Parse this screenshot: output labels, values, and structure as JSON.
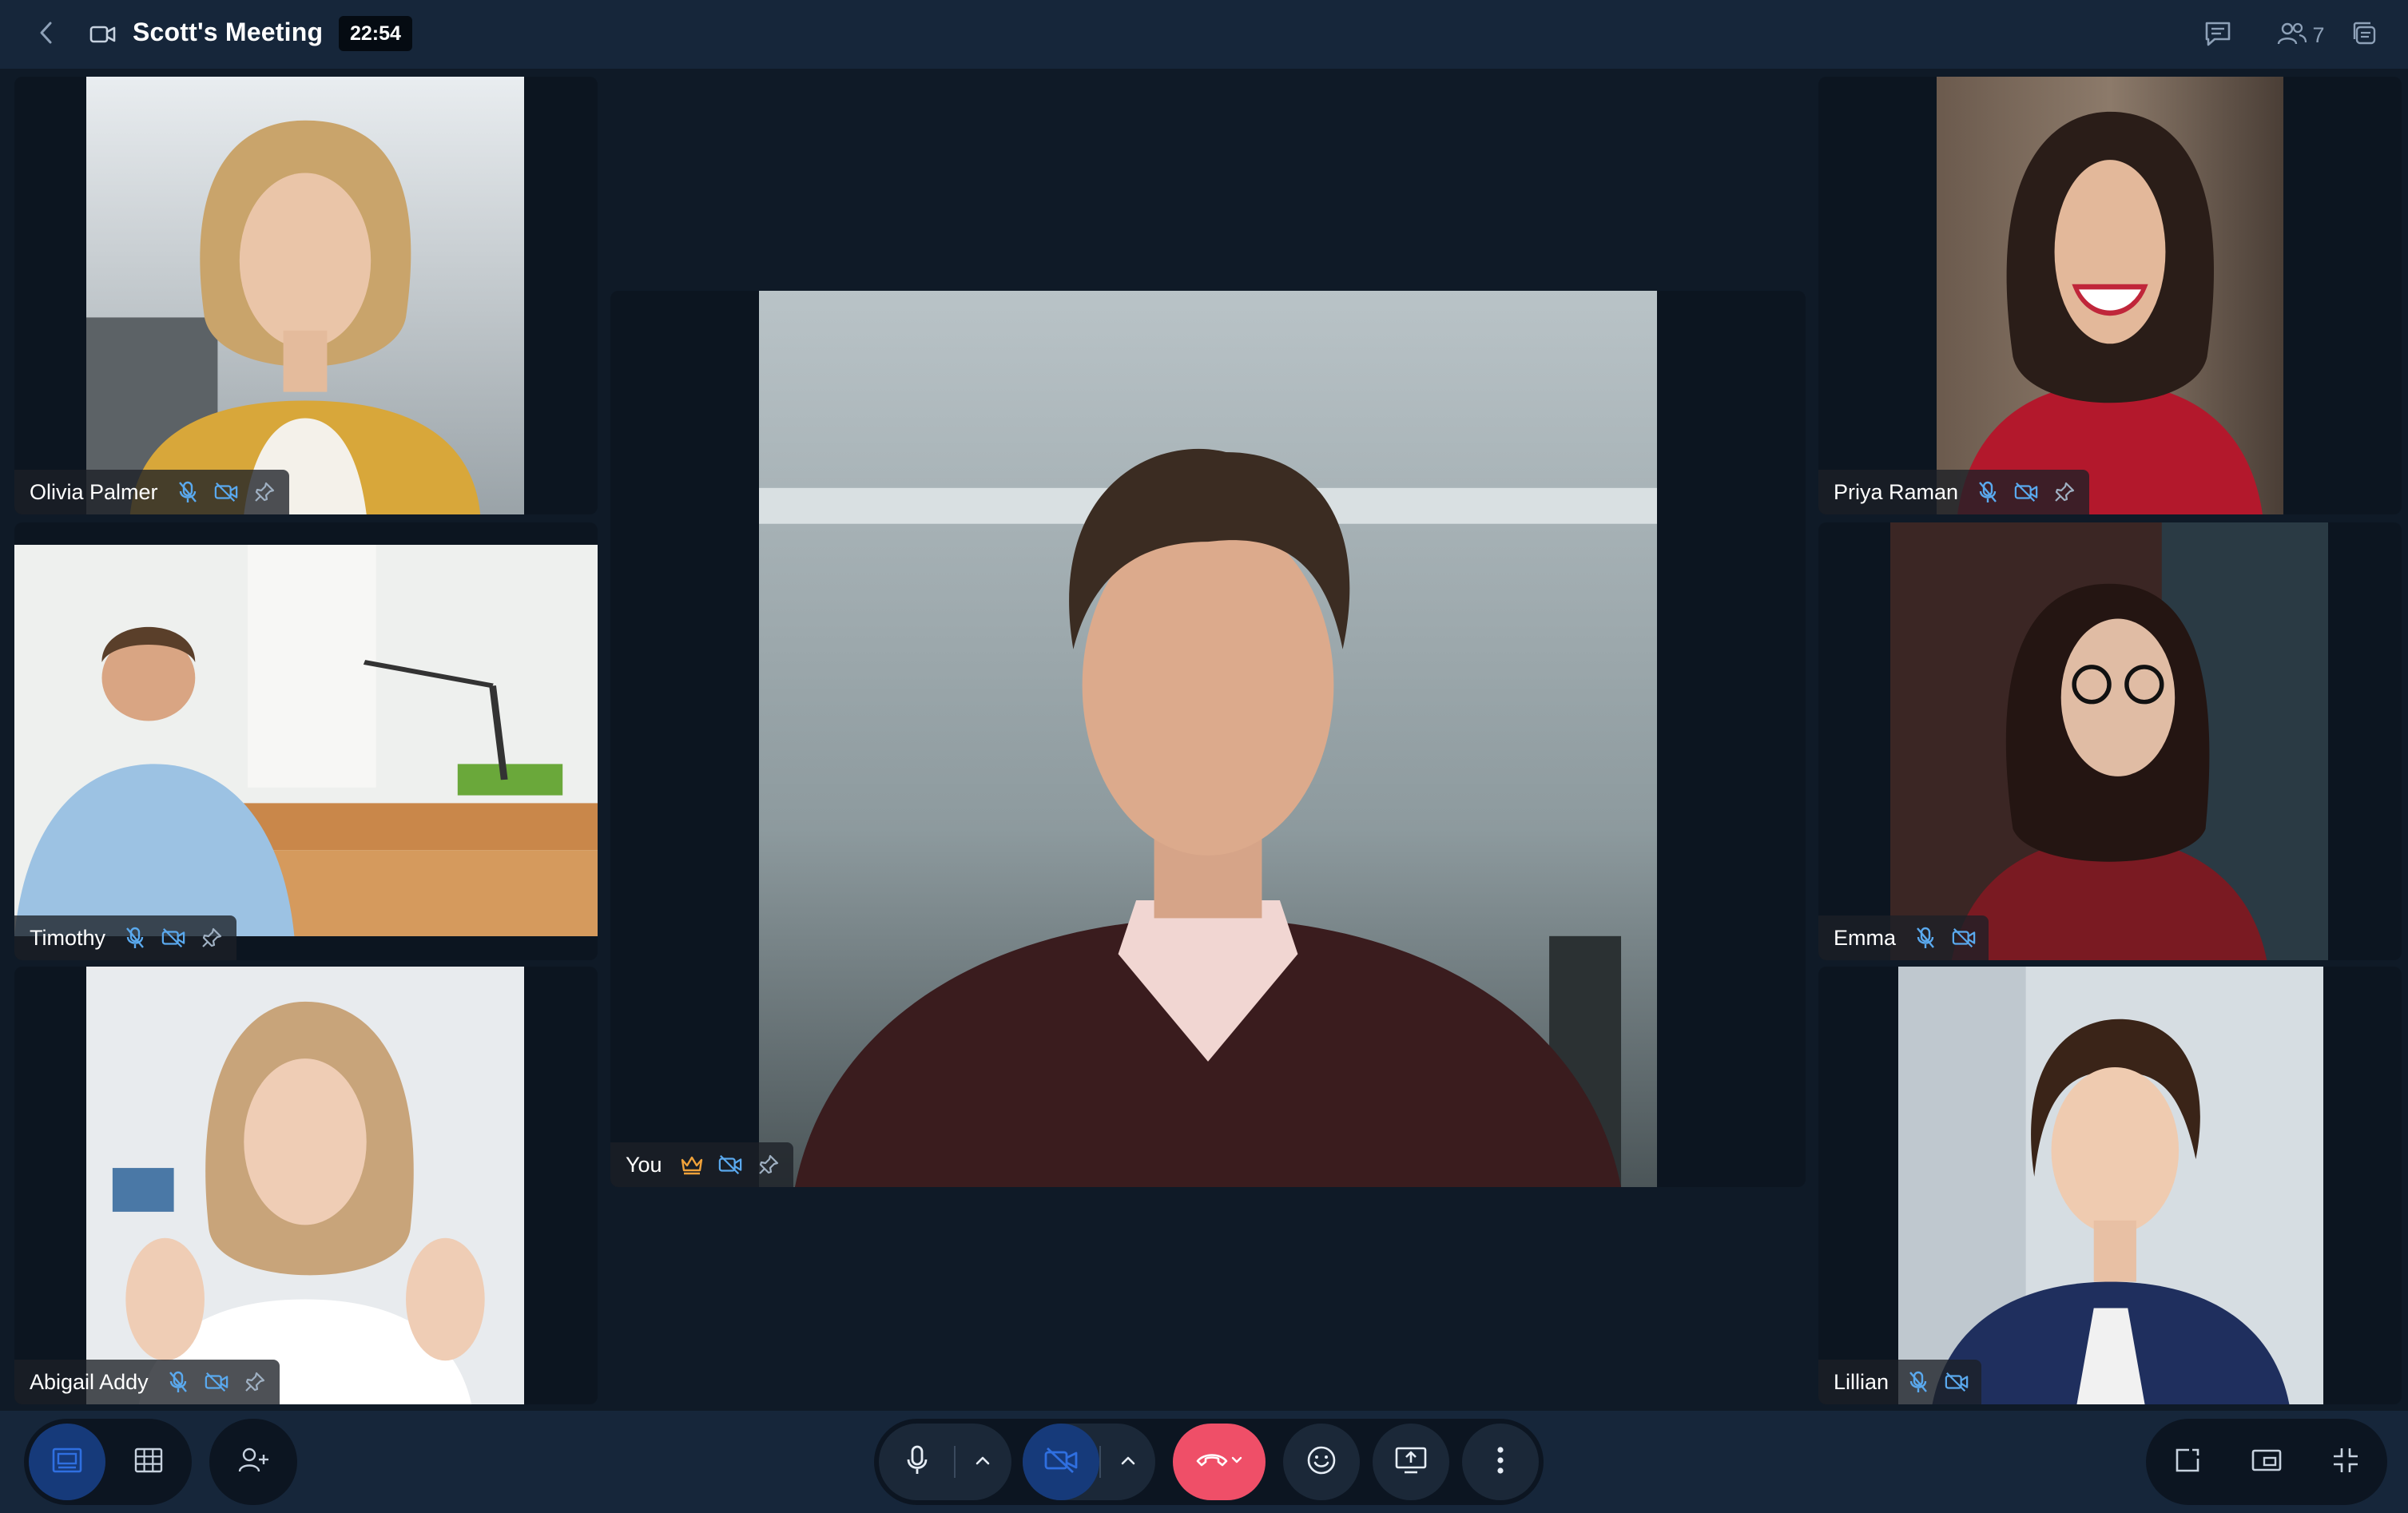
{
  "meeting": {
    "title": "Scott's Meeting",
    "timer": "22:54",
    "participant_count": "7"
  },
  "topbar": {
    "back_icon": "chevron-left-icon",
    "video_icon": "video-camera-icon",
    "right_icons": [
      "chat-icon",
      "participants-icon",
      "layers-icon"
    ]
  },
  "participants": [
    {
      "name": "Olivia Palmer",
      "icons": [
        "mic-muted-icon",
        "camera-off-icon",
        "pin-icon"
      ]
    },
    {
      "name": "Timothy",
      "icons": [
        "mic-muted-icon",
        "camera-off-icon",
        "pin-icon"
      ]
    },
    {
      "name": "Abigail Addy",
      "icons": [
        "mic-muted-icon",
        "camera-off-icon",
        "pin-icon"
      ]
    },
    {
      "name": "You",
      "icons": [
        "crown-icon",
        "camera-off-icon",
        "pin-icon"
      ]
    },
    {
      "name": "Priya Raman",
      "icons": [
        "mic-muted-icon",
        "camera-off-icon",
        "pin-icon"
      ]
    },
    {
      "name": "Emma",
      "icons": [
        "mic-muted-icon",
        "camera-off-icon"
      ]
    },
    {
      "name": "Lillian",
      "icons": [
        "mic-muted-icon",
        "camera-off-icon"
      ]
    }
  ],
  "controls": {
    "left": [
      "speaker-view-icon",
      "grid-view-icon",
      "add-participant-icon"
    ],
    "center": [
      "microphone-icon",
      "chevron-up-icon",
      "camera-off-icon",
      "chevron-up-icon",
      "end-call-icon",
      "emoji-icon",
      "share-screen-icon",
      "more-vertical-icon"
    ],
    "right": [
      "popout-icon",
      "pip-icon",
      "exit-fullscreen-icon"
    ]
  },
  "colors": {
    "background": "#0f1a27",
    "bar": "#16263a",
    "accent_blue": "#2f6fe0",
    "end_call": "#ef4f68",
    "icon_blue": "#5aa9ee",
    "crown": "#f0a23a"
  }
}
